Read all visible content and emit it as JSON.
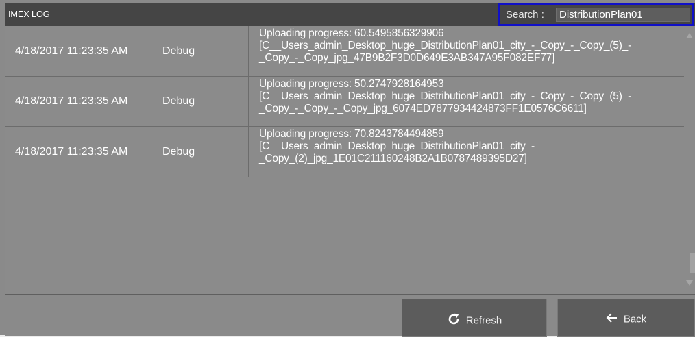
{
  "header": {
    "title": "IMEX LOG",
    "search_label": "Search :",
    "search_value": "DistributionPlan01"
  },
  "log_rows": [
    {
      "time": "4/18/2017 11:23:35 AM",
      "level": "Debug",
      "message": "Uploading progress: 60.5495856329906\n[C__Users_admin_Desktop_huge_DistributionPlan01_city_-_Copy_-_Copy_(5)_-\n_Copy_-_Copy_jpg_47B9B2F3D0D649E3AB347A95F082EF77]"
    },
    {
      "time": "4/18/2017 11:23:35 AM",
      "level": "Debug",
      "message": "Uploading progress: 50.2747928164953\n[C__Users_admin_Desktop_huge_DistributionPlan01_city_-_Copy_-_Copy_(5)_-\n_Copy_-_Copy_-_Copy_jpg_6074ED7877934424873FF1E0576C6611]"
    },
    {
      "time": "4/18/2017 11:23:35 AM",
      "level": "Debug",
      "message": "Uploading progress: 70.8243784494859\n[C__Users_admin_Desktop_huge_DistributionPlan01_city_-\n_Copy_(2)_jpg_1E01C211160248B2A1B0787489395D27]"
    }
  ],
  "buttons": {
    "refresh_label": "Refresh",
    "refresh_icon": "refresh-icon",
    "back_label": "Back",
    "back_icon": "arrow-left-icon"
  },
  "colors": {
    "search_highlight": "#1010c8",
    "header_bg": "#454545",
    "button_bg": "#5c5c5c"
  }
}
